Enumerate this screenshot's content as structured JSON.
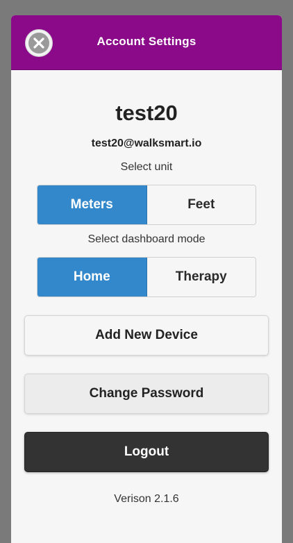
{
  "header": {
    "title": "Account Settings",
    "close_icon": "close-icon",
    "background_color": "#8a0a8a"
  },
  "account": {
    "username": "test20",
    "email": "test20@walksmart.io"
  },
  "unit": {
    "label": "Select unit",
    "options": [
      "Meters",
      "Feet"
    ],
    "selected": "Meters"
  },
  "dashboard": {
    "label": "Select dashboard mode",
    "options": [
      "Home",
      "Therapy"
    ],
    "selected": "Home"
  },
  "actions": {
    "add_device": "Add New Device",
    "change_password": "Change Password",
    "logout": "Logout"
  },
  "footer": {
    "version": "Verison 2.1.6"
  },
  "colors": {
    "accent": "#3388cc",
    "logout": "#333333"
  }
}
